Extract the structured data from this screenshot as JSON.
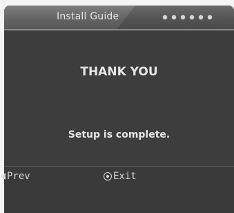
{
  "header": {
    "title": "Install Guide",
    "progress_dots": 6
  },
  "main": {
    "heading": "THANK YOU",
    "message": "Setup is complete."
  },
  "footer": {
    "prev_label": "Prev",
    "prev_icon": "left-triangle-icon",
    "exit_label": "Exit",
    "exit_icon": "circle-button-icon"
  },
  "colors": {
    "panel_bg": "#3d3d3d",
    "header_bg": "#5a5a5a",
    "text": "#e6e6e6"
  }
}
